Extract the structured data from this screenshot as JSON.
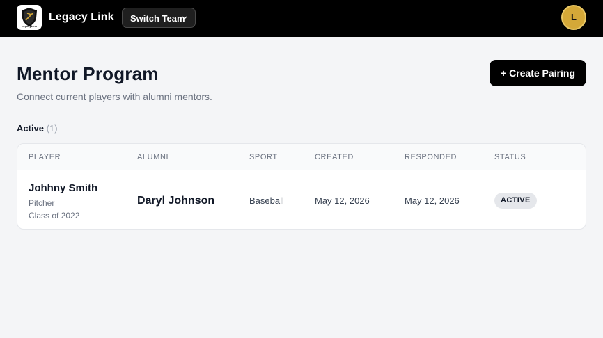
{
  "header": {
    "logo_text": "LegacyLink",
    "brand": "Legacy Link",
    "switch_team_label": "Switch Team",
    "avatar_initial": "L"
  },
  "page": {
    "title": "Mentor Program",
    "subtitle": "Connect current players with alumni mentors.",
    "create_button_label": "+ Create Pairing"
  },
  "section": {
    "label": "Active",
    "count": "(1)"
  },
  "table": {
    "columns": [
      "PLAYER",
      "ALUMNI",
      "SPORT",
      "CREATED",
      "RESPONDED",
      "STATUS"
    ],
    "rows": [
      {
        "player_name": "Johhny Smith",
        "player_position": "Pitcher",
        "player_class": "Class of 2022",
        "alumni": "Daryl Johnson",
        "sport": "Baseball",
        "created": "May 12, 2026",
        "responded": "May 12, 2026",
        "status": "ACTIVE"
      }
    ]
  },
  "colors": {
    "topbar": "#000000",
    "avatar": "#d4a838",
    "primary_button": "#000000",
    "status_badge": "#e5e7eb"
  }
}
